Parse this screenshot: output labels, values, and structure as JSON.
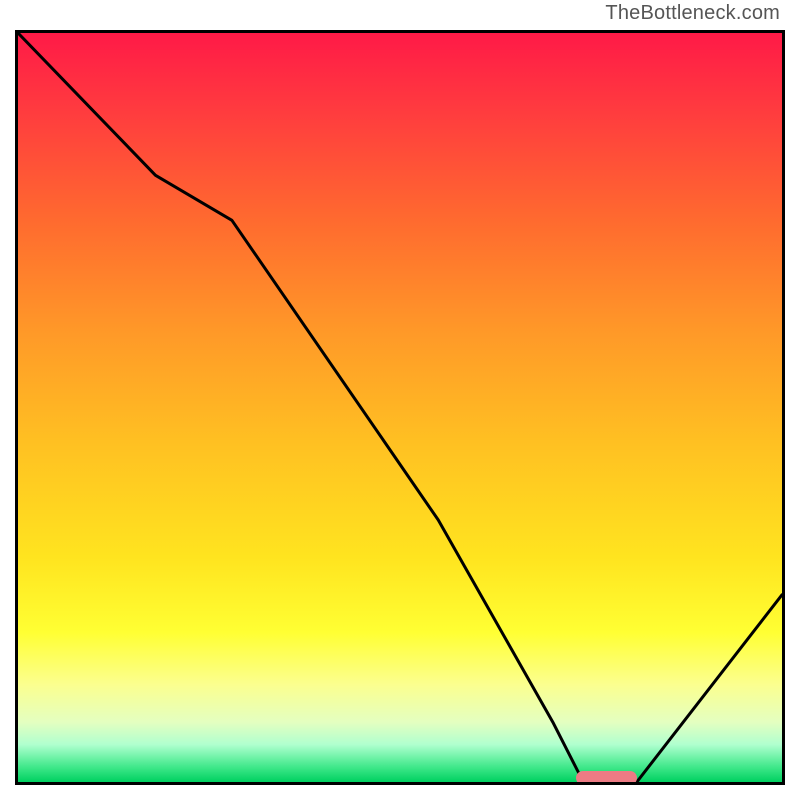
{
  "watermark": "TheBottleneck.com",
  "chart_data": {
    "type": "line",
    "title": "",
    "xlabel": "",
    "ylabel": "",
    "xlim": [
      0,
      100
    ],
    "ylim": [
      0,
      100
    ],
    "x": [
      0,
      18,
      28,
      55,
      70,
      73.5,
      78,
      81,
      100
    ],
    "values": [
      100,
      81,
      75,
      35,
      8,
      1,
      0,
      0,
      25
    ],
    "marker_segment": {
      "x_start": 73,
      "x_end": 81,
      "y": 0.5
    },
    "colors": {
      "gradient_top": "#ff1a47",
      "gradient_mid": "#ffe41f",
      "gradient_bottom": "#00d060",
      "curve": "#000000",
      "marker": "#ed7b84",
      "frame": "#000000"
    }
  }
}
